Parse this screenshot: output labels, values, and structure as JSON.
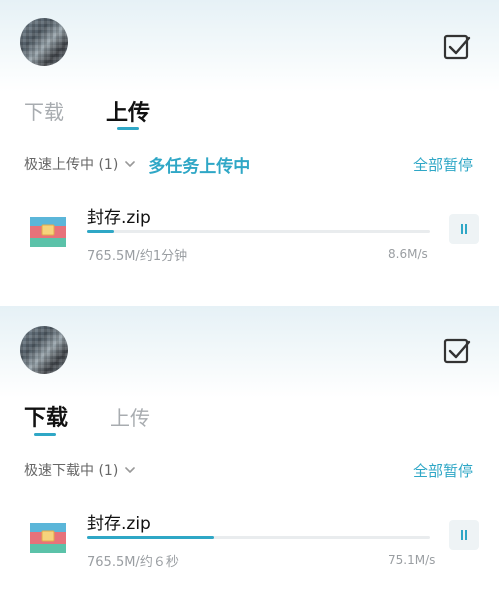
{
  "colors": {
    "accent": "#2fa7c6",
    "inactive_tab": "#a8acb0",
    "meta_text": "#9a9ea2"
  },
  "icons": {
    "select": "checkbox-check-icon",
    "file": "archive-zip-icon",
    "pause": "pause-icon",
    "dropdown": "chevron-down-icon"
  },
  "upload_view": {
    "tabs": [
      {
        "label": "下载",
        "active": false
      },
      {
        "label": "上传",
        "active": true
      }
    ],
    "speed_label": "极速上传中 (1)",
    "multi_task_label": "多任务上传中",
    "pause_all_label": "全部暂停",
    "file": {
      "name": "封存.zip",
      "meta": "765.5M/约1分钟",
      "speed": "8.6M/s",
      "progress": 0.08
    }
  },
  "download_view": {
    "tabs": [
      {
        "label": "下载",
        "active": true
      },
      {
        "label": "上传",
        "active": false
      }
    ],
    "speed_label": "极速下载中 (1)",
    "pause_all_label": "全部暂停",
    "file": {
      "name": "封存.zip",
      "meta": "765.5M/约６秒",
      "speed": "75.1M/s",
      "progress": 0.37
    }
  }
}
